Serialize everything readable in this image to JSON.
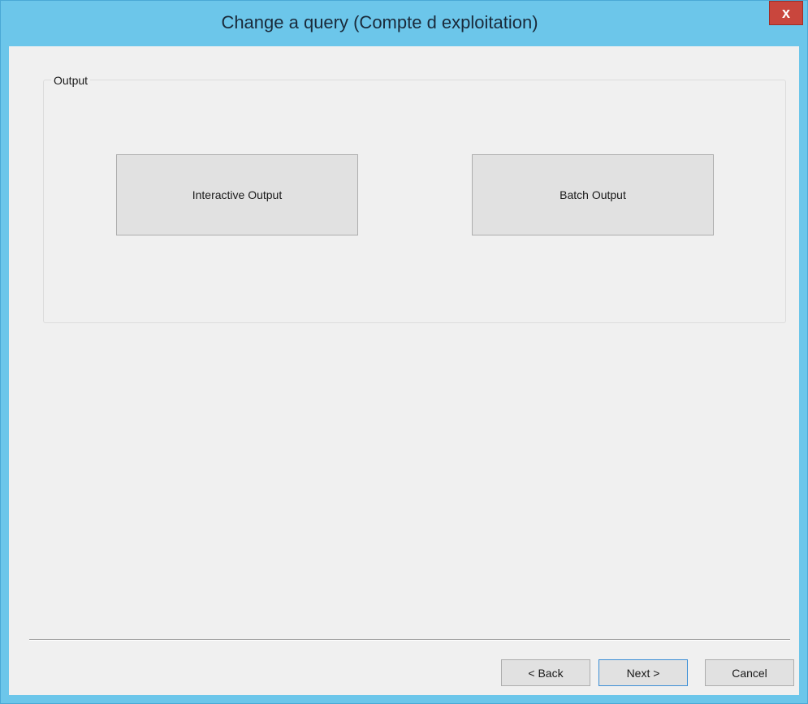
{
  "window": {
    "title": "Change a query (Compte d exploitation)",
    "close_label": "x"
  },
  "output_group": {
    "label": "Output",
    "interactive_label": "Interactive Output",
    "batch_label": "Batch Output"
  },
  "footer": {
    "back_label": "< Back",
    "next_label": "Next >",
    "cancel_label": "Cancel"
  },
  "colors": {
    "titlebar": "#6cc6ea",
    "close_button": "#c9463d",
    "client_background": "#f0f0f0",
    "button_face": "#e1e1e1",
    "default_button_border": "#3c8fd6"
  }
}
